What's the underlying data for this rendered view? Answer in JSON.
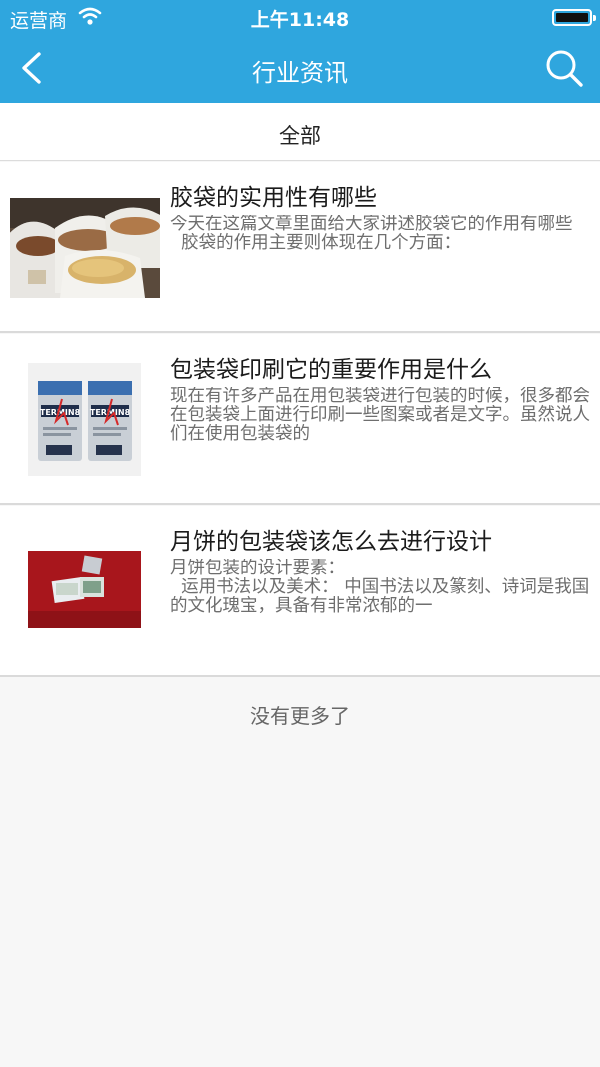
{
  "status_bar": {
    "carrier": "运营商",
    "time": "上午11:48"
  },
  "navbar": {
    "title": "行业资讯"
  },
  "tabs": {
    "active": "全部"
  },
  "articles": [
    {
      "title": "胶袋的实用性有哪些",
      "summary": "今天在这篇文章里面给大家讲述胶袋它的作用有哪些\n  胶袋的作用主要则体现在几个方面："
    },
    {
      "title": "包装袋印刷它的重要作用是什么",
      "summary": "现在有许多产品在用包装袋进行包装的时候，很多都会在包装袋上面进行印刷一些图案或者是文字。虽然说人们在使用包装袋的",
      "image_text": "TERMIN8"
    },
    {
      "title": "月饼的包装袋该怎么去进行设计",
      "summary": "月饼包装的设计要素：\n  运用书法以及美术： 中国书法以及篆刻、诗词是我国的文化瑰宝，具备有非常浓郁的一"
    }
  ],
  "footer": {
    "no_more": "没有更多了"
  }
}
